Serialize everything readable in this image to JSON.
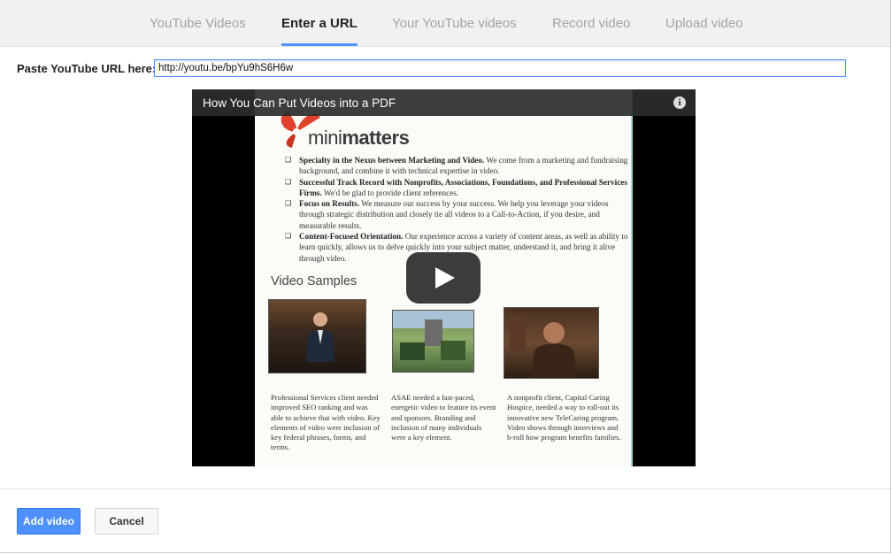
{
  "tabs": [
    {
      "label": "YouTube Videos",
      "active": false
    },
    {
      "label": "Enter a URL",
      "active": true
    },
    {
      "label": "Your YouTube videos",
      "active": false
    },
    {
      "label": "Record video",
      "active": false
    },
    {
      "label": "Upload video",
      "active": false
    }
  ],
  "url_field": {
    "label": "Paste YouTube URL here:",
    "value": "http://youtu.be/bpYu9hS6H6w"
  },
  "video": {
    "title": "How You Can Put Videos into a PDF",
    "info_icon": "i",
    "logo": {
      "part1": "mini",
      "part2": "matters"
    },
    "bullets": [
      {
        "head": "Specialty in the Nexus between Marketing and Video.",
        "text": " We come from a marketing and fundraising background, and combine it with technical expertise in video."
      },
      {
        "head": "Successful Track Record with Nonprofits, Associations, Foundations, and Professional Services Firms.",
        "text": " We'd be glad to provide client references."
      },
      {
        "head": "Focus on Results.",
        "text": " We measure our success by your success. We help you leverage your videos through strategic distribution and closely tie all videos to a Call-to-Action, if you desire, and measurable results."
      },
      {
        "head": "Content-Focused Orientation.",
        "text": " Our experience across a variety of content areas, as well as ability to learn quickly, allows us to delve quickly into your subject matter, understand it, and bring it alive through video."
      }
    ],
    "samples_heading": "Video Samples",
    "captions": [
      "Professional Services client needed improved SEO ranking and was able to achieve that with video. Key elements of video were inclusion of key federal phrases, forms, and terms.",
      "ASAE needed a fast-paced, energetic video to feature its event and sponsors. Branding and inclusion of many individuals were a key element.",
      "A nonprofit client, Capital Caring Hospice, needed a way to roll-out its innovative new TeleCaring program. Video shows through interviews and b-roll how program benefits families."
    ]
  },
  "buttons": {
    "add": "Add video",
    "cancel": "Cancel"
  },
  "colors": {
    "accent": "#4d90fe",
    "logo_red": "#e0432b"
  }
}
